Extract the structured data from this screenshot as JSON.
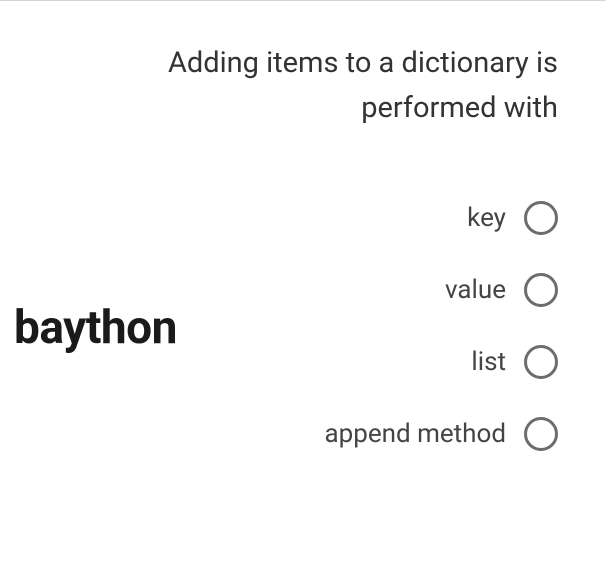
{
  "question": {
    "line1": "Adding items to a dictionary is",
    "line2": "performed with"
  },
  "options": [
    {
      "label": "key"
    },
    {
      "label": "value"
    },
    {
      "label": "list"
    },
    {
      "label": "append method"
    }
  ],
  "watermark": "baython"
}
